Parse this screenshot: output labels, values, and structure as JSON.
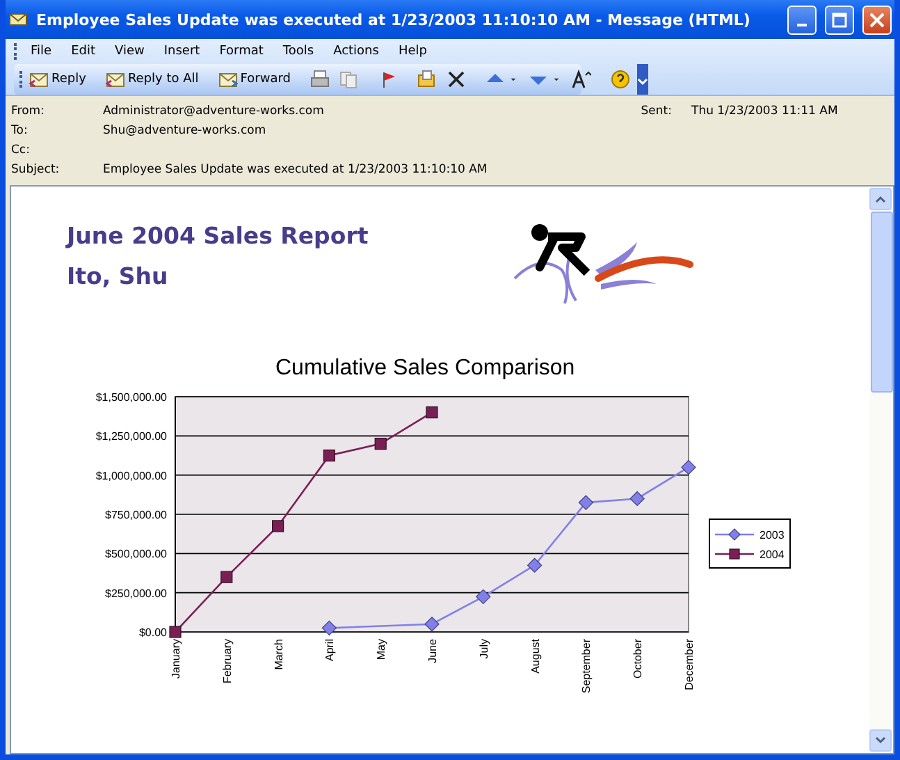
{
  "window": {
    "title": "Employee Sales Update was executed at 1/23/2003 11:10:10 AM - Message (HTML)"
  },
  "menu": [
    "File",
    "Edit",
    "View",
    "Insert",
    "Format",
    "Tools",
    "Actions",
    "Help"
  ],
  "toolbar": [
    {
      "kind": "reply",
      "label": "Reply"
    },
    {
      "kind": "reply-all",
      "label": "Reply to All"
    },
    {
      "kind": "forward",
      "label": "Forward"
    }
  ],
  "header": {
    "from_label": "From:",
    "from": "Administrator@adventure-works.com",
    "to_label": "To:",
    "to": "Shu@adventure-works.com",
    "cc_label": "Cc:",
    "subject_label": "Subject:",
    "subject": "Employee Sales Update was executed at 1/23/2003 11:10:10 AM",
    "sent_label": "Sent:",
    "sent": "Thu 1/23/2003 11:11 AM"
  },
  "report": {
    "title": "June 2004 Sales Report",
    "employee": "Ito, Shu"
  },
  "chart_data": {
    "type": "line",
    "title": "Cumulative Sales Comparison",
    "categories": [
      "January",
      "February",
      "March",
      "April",
      "May",
      "June",
      "July",
      "August",
      "September",
      "October",
      "December"
    ],
    "ylim": [
      0,
      1500000
    ],
    "grid": true,
    "legend": true,
    "yticks": [
      {
        "value": 0,
        "label": "$0.00"
      },
      {
        "value": 250000,
        "label": "$250,000.00"
      },
      {
        "value": 500000,
        "label": "$500,000.00"
      },
      {
        "value": 750000,
        "label": "$750,000.00"
      },
      {
        "value": 1000000,
        "label": "$1,000,000.00"
      },
      {
        "value": 1250000,
        "label": "$1,250,000.00"
      },
      {
        "value": 1500000,
        "label": "$1,500,000.00"
      }
    ],
    "series": [
      {
        "name": "2003",
        "color": "#8080e8",
        "marker": "diamond",
        "values": [
          null,
          null,
          null,
          25000,
          null,
          50000,
          225000,
          425000,
          825000,
          850000,
          1050000
        ]
      },
      {
        "name": "2004",
        "color": "#7a1f55",
        "marker": "square",
        "values": [
          0,
          350000,
          675000,
          1125000,
          1200000,
          1400000,
          null,
          null,
          null,
          null,
          null
        ]
      }
    ]
  }
}
